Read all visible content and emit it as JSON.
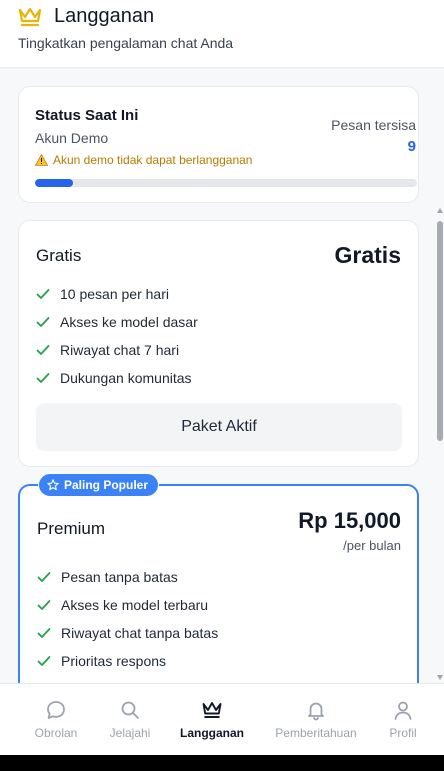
{
  "header": {
    "title": "Langganan",
    "subtitle": "Tingkatkan pengalaman chat Anda",
    "icon": "crown-icon"
  },
  "status": {
    "title": "Status Saat Ini",
    "account": "Akun Demo",
    "warning": "Akun demo tidak dapat berlangganan",
    "remaining_label": "Pesan tersisa",
    "remaining_count": "9",
    "progress_fraction": 0.1
  },
  "plans": {
    "free": {
      "name": "Gratis",
      "price": "Gratis",
      "features": [
        "10 pesan per hari",
        "Akses ke model dasar",
        "Riwayat chat 7 hari",
        "Dukungan komunitas"
      ],
      "button_label": "Paket Aktif"
    },
    "premium": {
      "badge": "Paling Populer",
      "name": "Premium",
      "price": "Rp 15,000",
      "period": "/per bulan",
      "features": [
        "Pesan tanpa batas",
        "Akses ke model terbaru",
        "Riwayat chat tanpa batas",
        "Prioritas respons"
      ]
    }
  },
  "nav": {
    "items": [
      {
        "label": "Obrolan",
        "icon": "chat-bubble-icon",
        "active": false
      },
      {
        "label": "Jelajahi",
        "icon": "search-icon",
        "active": false
      },
      {
        "label": "Langganan",
        "icon": "crown-icon",
        "active": true
      },
      {
        "label": "Pemberitahuan",
        "icon": "bell-icon",
        "active": false
      },
      {
        "label": "Profil",
        "icon": "user-icon",
        "active": false
      }
    ]
  },
  "colors": {
    "accent": "#2563eb",
    "premium_border": "#3b82f6",
    "check": "#22a34a",
    "warning": "#b77b00",
    "crown": "#eab308"
  }
}
